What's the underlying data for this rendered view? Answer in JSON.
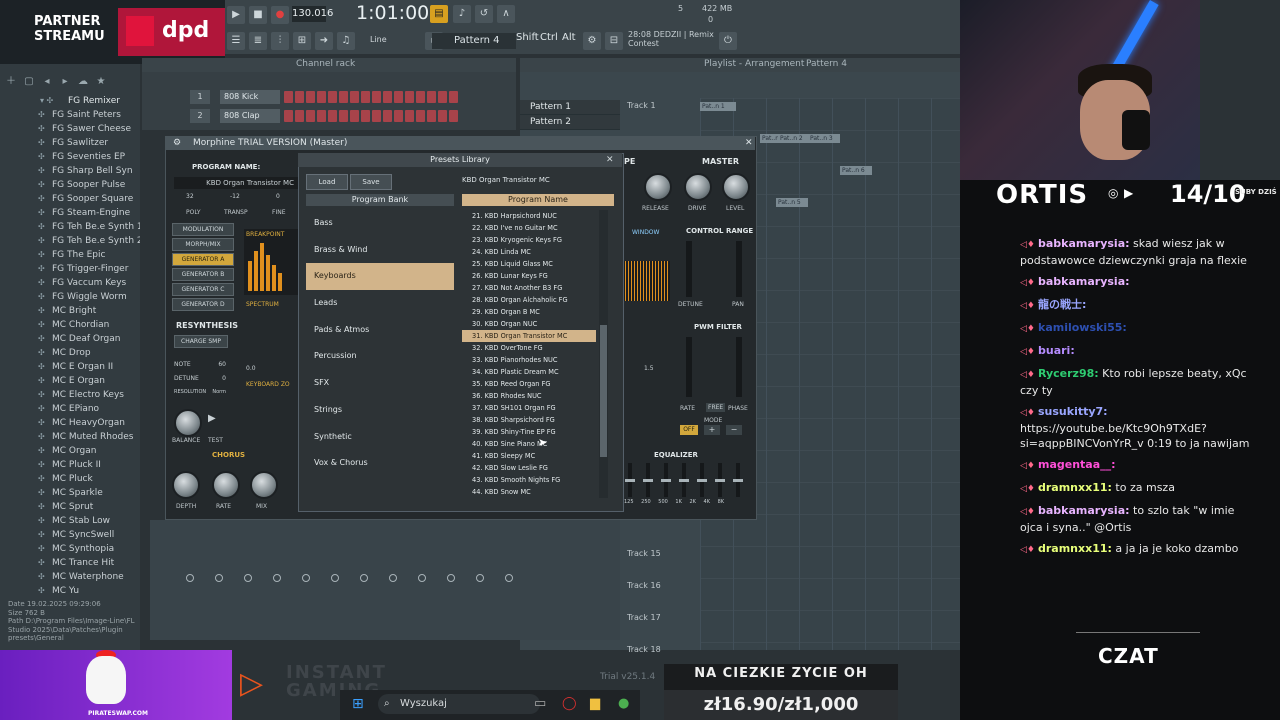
{
  "partner": {
    "line1": "PARTNER",
    "line2": "STREAMU",
    "brand": "dpd"
  },
  "toolbar": {
    "tempo": "130.016",
    "time": "1:01:00",
    "line_mode": "Line",
    "pattern": "Pattern 4",
    "meter_top": "5",
    "meter_mem": "422 MB",
    "meter_zero": "0",
    "song_time": "28:08",
    "song_name": "DEDZII | Remix",
    "song_sub": "Contest",
    "shortcuts": [
      "Shift",
      "Ctrl",
      "Alt"
    ]
  },
  "browser": {
    "items": [
      "FG Remixer",
      "FG Saint Peters",
      "FG Sawer Cheese",
      "FG Sawlitzer",
      "FG Seventies EP",
      "FG Sharp Bell Syn",
      "FG Sooper Pulse",
      "FG Sooper Square",
      "FG Steam-Engine",
      "FG Teh Be.e Synth 1",
      "FG Teh Be.e Synth 2",
      "FG The Epic",
      "FG Trigger-Finger",
      "FG Vaccum Keys",
      "FG Wiggle Worm",
      "MC Bright",
      "MC Chordian",
      "MC Deaf Organ",
      "MC Drop",
      "MC E Organ II",
      "MC E Organ",
      "MC Electro Keys",
      "MC EPiano",
      "MC HeavyOrgan",
      "MC Muted Rhodes",
      "MC Organ",
      "MC Pluck II",
      "MC Pluck",
      "MC Sparkle",
      "MC Sprut",
      "MC Stab Low",
      "MC SyncSwell",
      "MC Synthopia",
      "MC Trance Hit",
      "MC Waterphone",
      "MC Yu"
    ],
    "file_info": [
      "Date 19.02.2025 09:29:06",
      "Size 762 B",
      "Path D:\\Program Files\\Image-Line\\FL Studio 2025\\Data\\Patches\\Plugin presets\\General"
    ]
  },
  "channel_rack": {
    "title": "Channel rack",
    "channels": [
      {
        "num": "1",
        "name": "808 Kick"
      },
      {
        "num": "2",
        "name": "808 Clap"
      }
    ]
  },
  "playlist": {
    "title": "Playlist - Arrangement",
    "pattern": "Pattern 4",
    "patterns": [
      "Pattern 1",
      "Pattern 2"
    ],
    "tracks": [
      "Track 1",
      "Track 15",
      "Track 16",
      "Track 17",
      "Track 18"
    ],
    "clip_labels": [
      "Pat..n 1",
      "Pat..n 2",
      "Pat..n 3",
      "Pat..n 6",
      "Pat..n 5"
    ]
  },
  "morphine": {
    "title": "Morphine TRIAL VERSION (Master)",
    "program_label": "PROGRAM NAME:",
    "program_value": "KBD Organ Transistor MC",
    "top_values": [
      "32",
      "-12",
      "0"
    ],
    "top_labels": [
      "POLY",
      "TRANSP",
      "FINE"
    ],
    "left_buttons": [
      "MODULATION",
      "MORPH/MIX",
      "GENERATOR A",
      "GENERATOR B",
      "GENERATOR C",
      "GENERATOR D"
    ],
    "tabs": [
      "BREAKPOINT",
      "SPECTRUM"
    ],
    "resynth": {
      "title": "RESYNTHESIS",
      "charge": "CHARGE SMP",
      "rows": [
        {
          "label": "NOTE",
          "value": "60"
        },
        {
          "label": "DETUNE",
          "value": "0"
        },
        {
          "label": "RESOLUTION",
          "value": "Norm"
        }
      ]
    },
    "balance": "BALANCE",
    "test": "TEST",
    "keyboard": "KEYBOARD ZO",
    "chorus": {
      "title": "CHORUS",
      "knobs": [
        "DEPTH",
        "RATE",
        "MIX"
      ]
    },
    "master": {
      "title": "MASTER",
      "knobs": [
        "RELEASE",
        "DRIVE",
        "LEVEL"
      ]
    },
    "type_frag": "PE",
    "window": "WINDOW",
    "control_range": {
      "title": "CONTROL RANGE",
      "labels": [
        "DETUNE",
        "PAN"
      ]
    },
    "pwm": {
      "title": "PWM FILTER",
      "labels": [
        "RATE",
        "FREE",
        "PHASE"
      ],
      "mode": "MODE",
      "off": "OFF"
    },
    "equalizer": {
      "title": "EQUALIZER",
      "bands": [
        "125",
        "250",
        "500",
        "1K",
        "2K",
        "4K",
        "8K"
      ]
    },
    "value_15": "1.5",
    "value_00": "0.0"
  },
  "presets": {
    "title": "Presets Library",
    "load": "Load",
    "save": "Save",
    "current": "KBD Organ Transistor MC",
    "bank_header": "Program Bank",
    "name_header": "Program Name",
    "banks": [
      "Bass",
      "Brass & Wind",
      "Keyboards",
      "Leads",
      "Pads & Atmos",
      "Percussion",
      "SFX",
      "Strings",
      "Synthetic",
      "Vox & Chorus"
    ],
    "selected_bank": 2,
    "programs": [
      "21. KBD Harpsichord NUC",
      "22. KBD I've no Guitar MC",
      "23. KBD Kryogenic Keys FG",
      "24. KBD Linda MC",
      "25. KBD Liquid Glass MC",
      "26. KBD Lunar Keys FG",
      "27. KBD Not Another B3 FG",
      "28. KBD Organ Alchaholic FG",
      "29. KBD Organ B MC",
      "30. KBD Organ NUC",
      "31. KBD Organ Transistor MC",
      "32. KBD OverTone FG",
      "33. KBD Pianorhodes NUC",
      "34. KBD Plastic Dream MC",
      "35. KBD Reed Organ FG",
      "36. KBD Rhodes NUC",
      "37. KBD SH101 Organ FG",
      "38. KBD Sharpsichord FG",
      "39. KBD Shiny-Tine EP FG",
      "40. KBD Sine Piano MC",
      "41. KBD Sleepy MC",
      "42. KBD Slow Leslie FG",
      "43. KBD Smooth Nights FG",
      "44. KBD Snow MC"
    ],
    "selected_program": 10
  },
  "stream": {
    "name": "ORTIS",
    "subs": "14/10",
    "subs_label": "SUBY DZIŚ",
    "chat_label": "CZAT",
    "chat": [
      {
        "user": "babkamarysia:",
        "text": "skad wiesz jak w podstawowce dziewczynki graja na flexie",
        "color": "#e8b4ff"
      },
      {
        "user": "babkamarysia:",
        "text": "",
        "color": "#e8b4ff"
      },
      {
        "user": "龍の戦士:",
        "text": "",
        "color": "#9aa6ff"
      },
      {
        "user": "kamilowski55:",
        "text": "",
        "color": "#2d4fb0"
      },
      {
        "user": "buari:",
        "text": "",
        "color": "#b58cff"
      },
      {
        "user": "Rycerz98:",
        "text": "Kto robi lepsze beaty, xQc czy ty",
        "color": "#2ecc71"
      },
      {
        "user": "susukitty7:",
        "text": "https://youtube.be/Ktc9Oh9TXdE?si=aqppBINCVonYrR_v 0:19 to ja nawijam",
        "color": "#9aa6ff"
      },
      {
        "user": "magentaa__:",
        "text": "",
        "color": "#ff4fd8"
      },
      {
        "user": "dramnxx11:",
        "text": "to za msza",
        "color": "#e8ff7a"
      },
      {
        "user": "babkamarysia:",
        "text": "to szlo tak \"w imie ojca i syna..\" @Ortis",
        "color": "#e8b4ff"
      },
      {
        "user": "dramnxx11:",
        "text": "a ja ja je koko dzambo",
        "color": "#e8ff7a"
      }
    ]
  },
  "bottom": {
    "pirate": "PIRATESWAP.COM",
    "instant": [
      "INSTANT",
      "GAMING"
    ],
    "search": "Wyszukaj",
    "trial": "Trial v25.1.4",
    "goal_title": "NA CIEZKIE ZYCIE OH",
    "goal_value": "zł16.90/zł1,000"
  }
}
